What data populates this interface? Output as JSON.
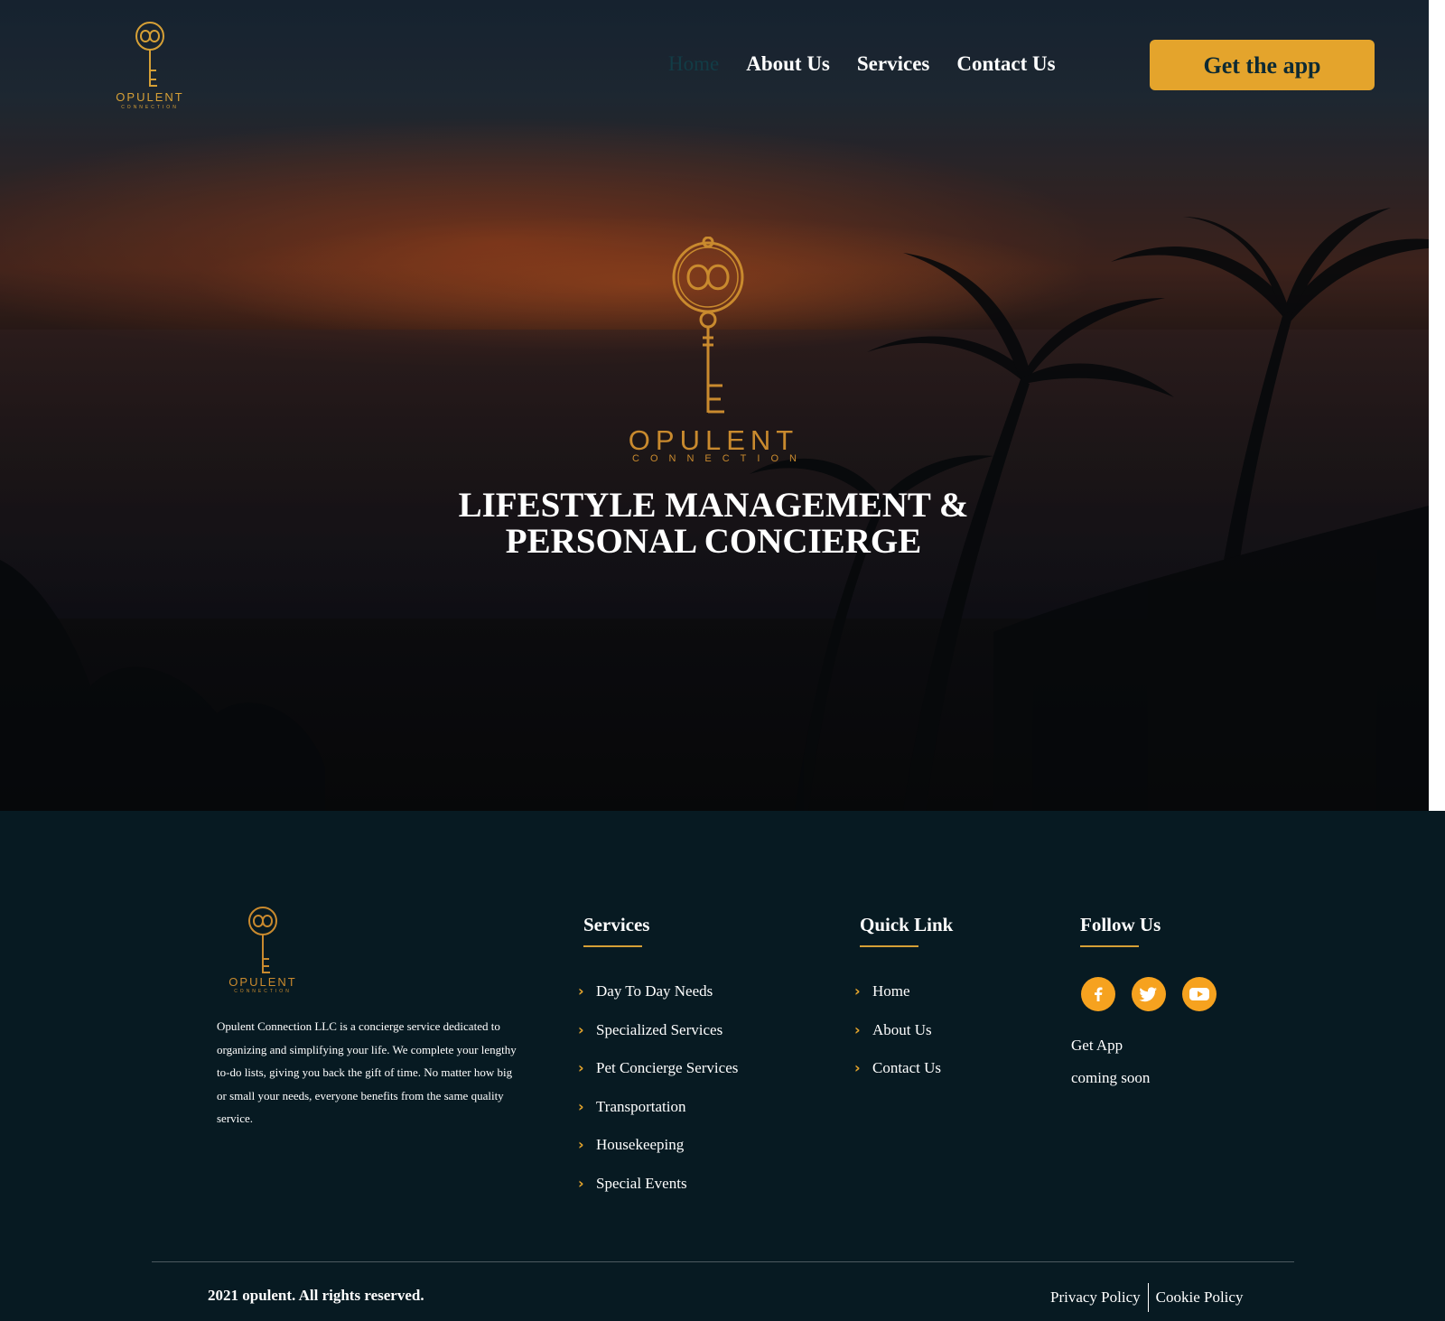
{
  "brand": {
    "name": "OPULENT",
    "tagline": "CONNECTION"
  },
  "nav": {
    "items": [
      {
        "label": "Home",
        "active": true
      },
      {
        "label": "About Us",
        "active": false
      },
      {
        "label": "Services",
        "active": false
      },
      {
        "label": "Contact Us",
        "active": false
      }
    ],
    "cta_label": "Get the app"
  },
  "hero": {
    "headline_line1": "LIFESTYLE MANAGEMENT &",
    "headline_line2": "PERSONAL CONCIERGE"
  },
  "footer": {
    "description": "Opulent Connection LLC is a concierge service dedicated to organizing and simplifying your life. We complete your lengthy to-do lists, giving you back the gift of time. No matter how big or small your needs, everyone benefits from the same quality service.",
    "services_title": "Services",
    "services": [
      "Day To Day Needs",
      "Specialized Services",
      "Pet Concierge Services",
      "Transportation",
      "Housekeeping",
      "Special Events"
    ],
    "quicklink_title": "Quick Link",
    "quicklinks": [
      "Home",
      "About Us",
      "Contact Us"
    ],
    "follow_title": "Follow Us",
    "social_icons": [
      "facebook-icon",
      "twitter-icon",
      "youtube-icon"
    ],
    "get_app": "Get App",
    "coming_soon": "coming soon",
    "copyright": "2021 opulent. All rights reserved.",
    "privacy": "Privacy Policy",
    "cookie": "Cookie Policy"
  },
  "colors": {
    "accent": "#e4a42c",
    "footer_bg": "#071a22",
    "logo_gold": "#c98a2e"
  }
}
